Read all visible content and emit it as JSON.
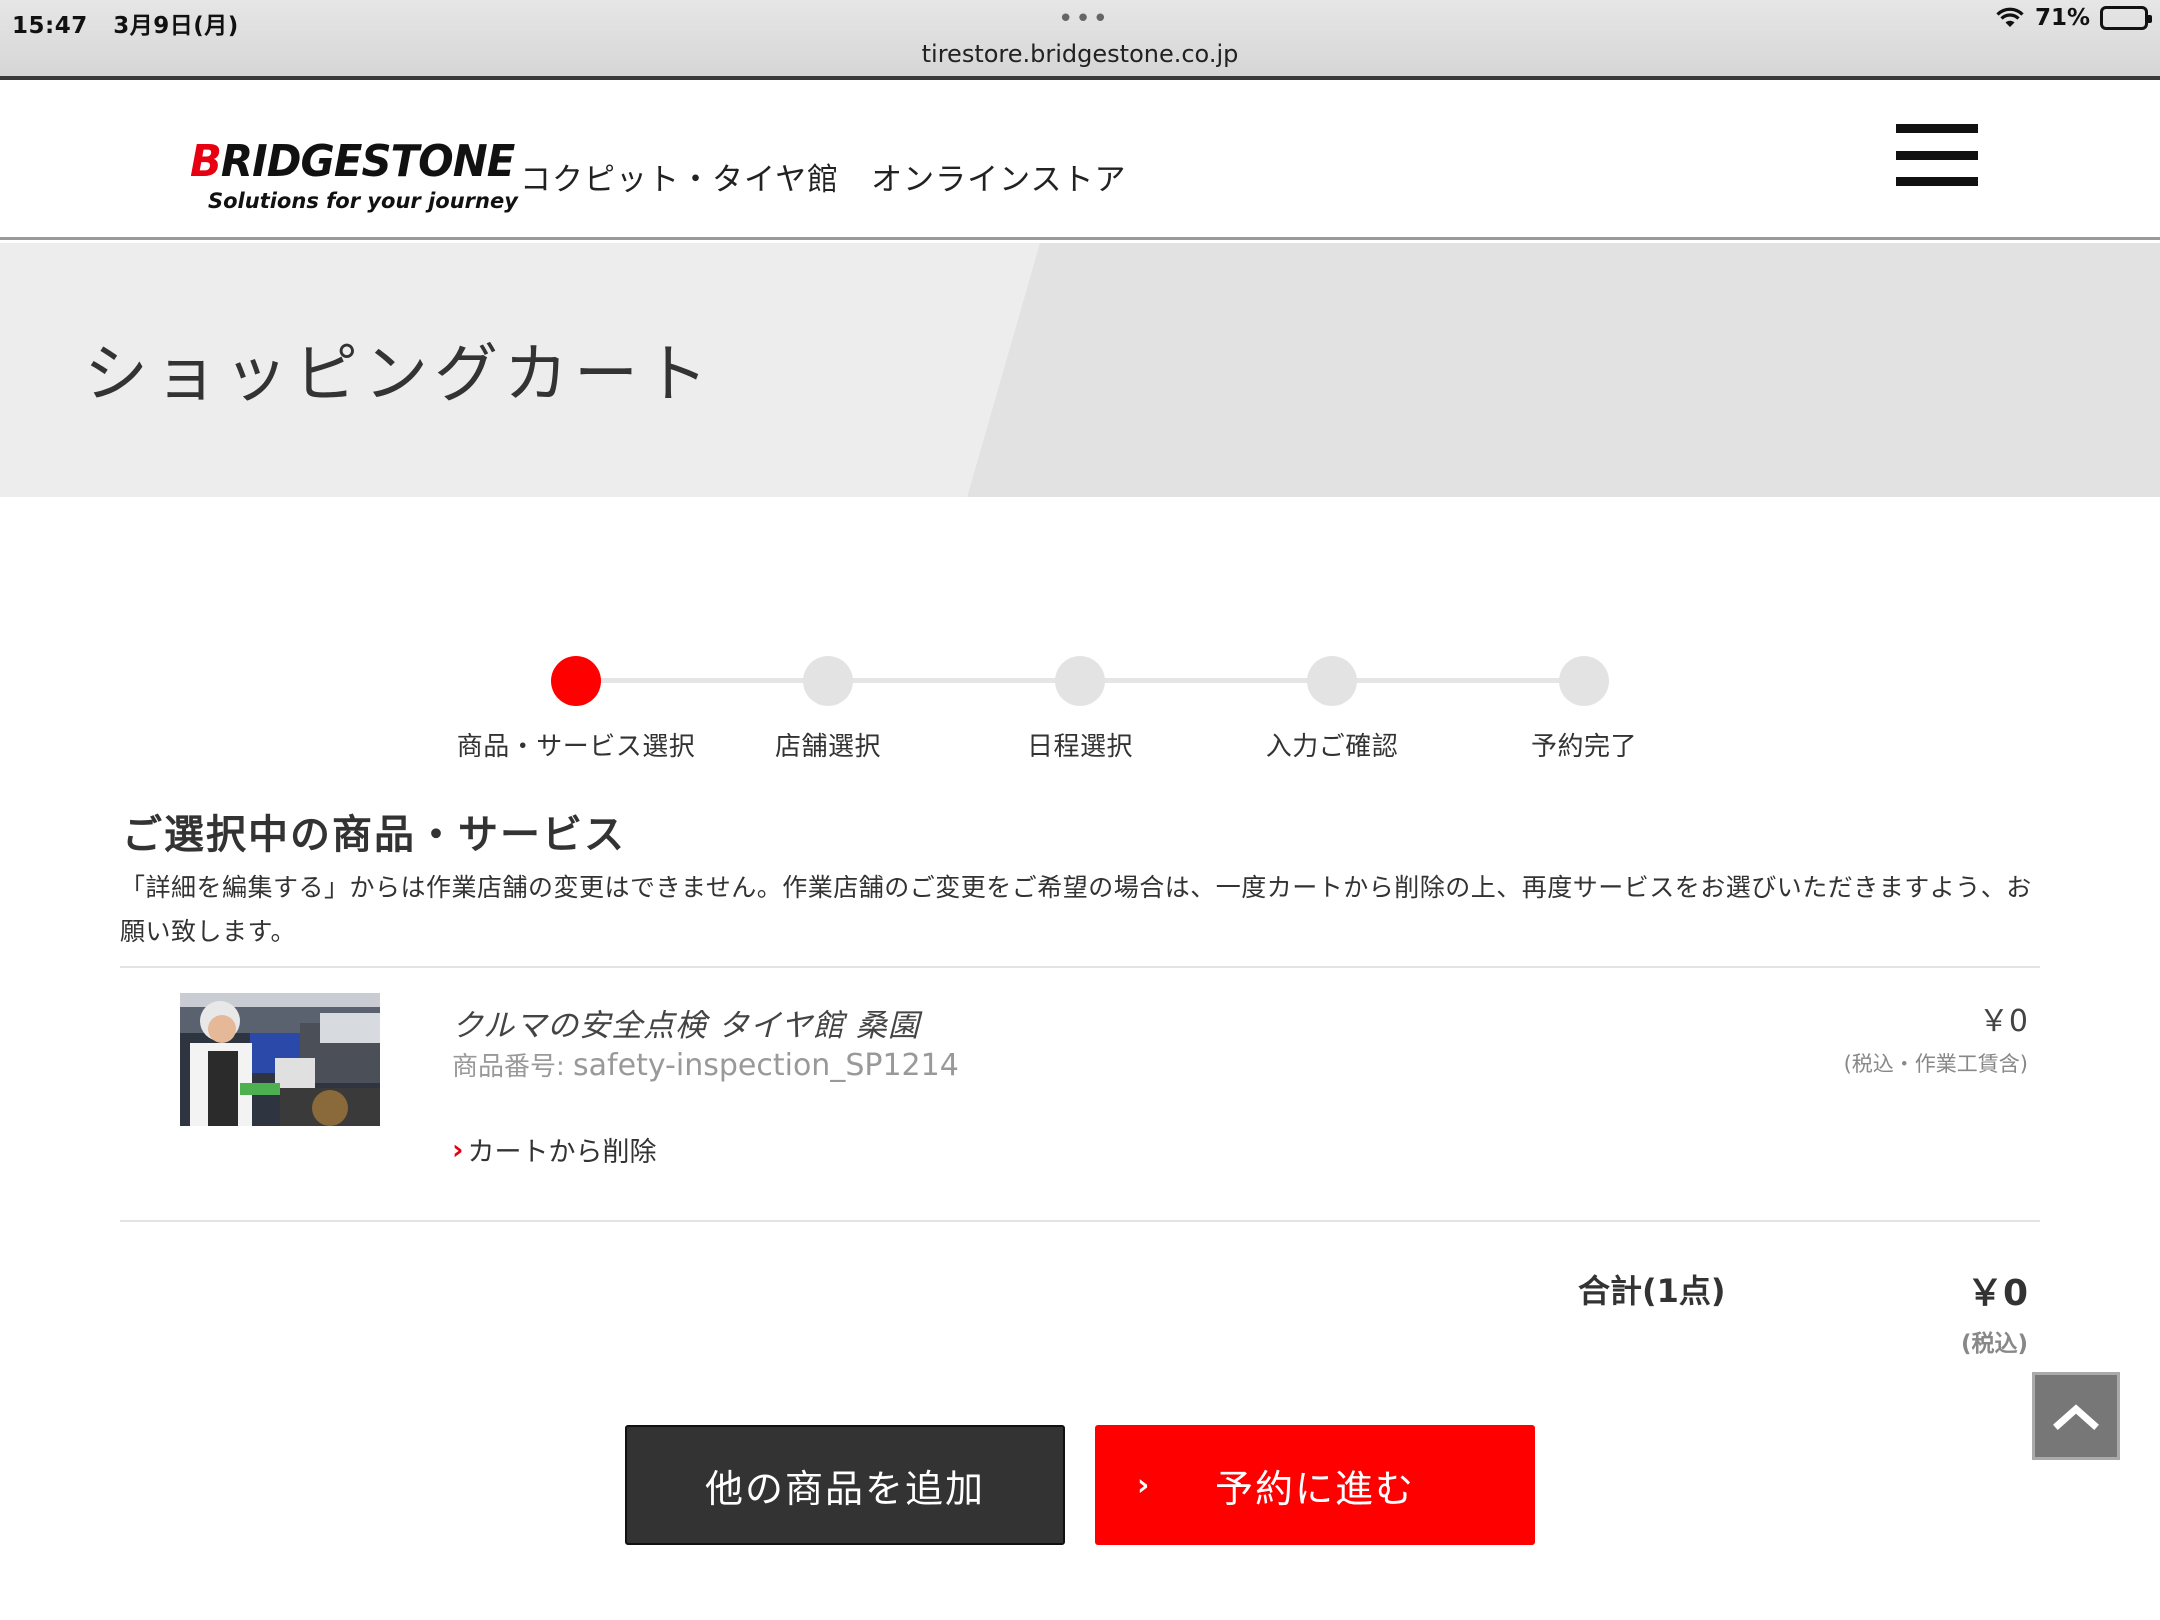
{
  "status_bar": {
    "time": "15:47",
    "date": "3月9日(月)",
    "battery": "71%",
    "battery_level": 0.71,
    "url": "tirestore.bridgestone.co.jp"
  },
  "header": {
    "logo_text_b": "B",
    "logo_text_rest": "RIDGESTONE",
    "logo_tagline": "Solutions for your journey",
    "site_name": "コクピット・タイヤ館　オンラインストア"
  },
  "hero": {
    "title": "ショッピングカート"
  },
  "steps": [
    {
      "label": "商品・サービス選択",
      "active": true
    },
    {
      "label": "店舗選択",
      "active": false
    },
    {
      "label": "日程選択",
      "active": false
    },
    {
      "label": "入力ご確認",
      "active": false
    },
    {
      "label": "予約完了",
      "active": false
    }
  ],
  "section": {
    "title": "ご選択中の商品・サービス",
    "notice": "「詳細を編集する」からは作業店舗の変更はできません。作業店舗のご変更をご希望の場合は、一度カートから削除の上、再度サービスをお選びいただきますよう、お願い致します。"
  },
  "item": {
    "name": "クルマの安全点検 タイヤ館 桑園",
    "code_label": "商品番号: ",
    "code": "safety-inspection_SP1214",
    "delete_label": "カートから削除",
    "price": "￥0",
    "tax_note": "(税込・作業工賃含)"
  },
  "total": {
    "label": "合計(1点)",
    "value": "￥0",
    "tax_note": "(税込)"
  },
  "buttons": {
    "add": "他の商品を追加",
    "next": "予約に進む"
  },
  "colors": {
    "accent": "#ff0000",
    "dark_button": "#333333"
  }
}
